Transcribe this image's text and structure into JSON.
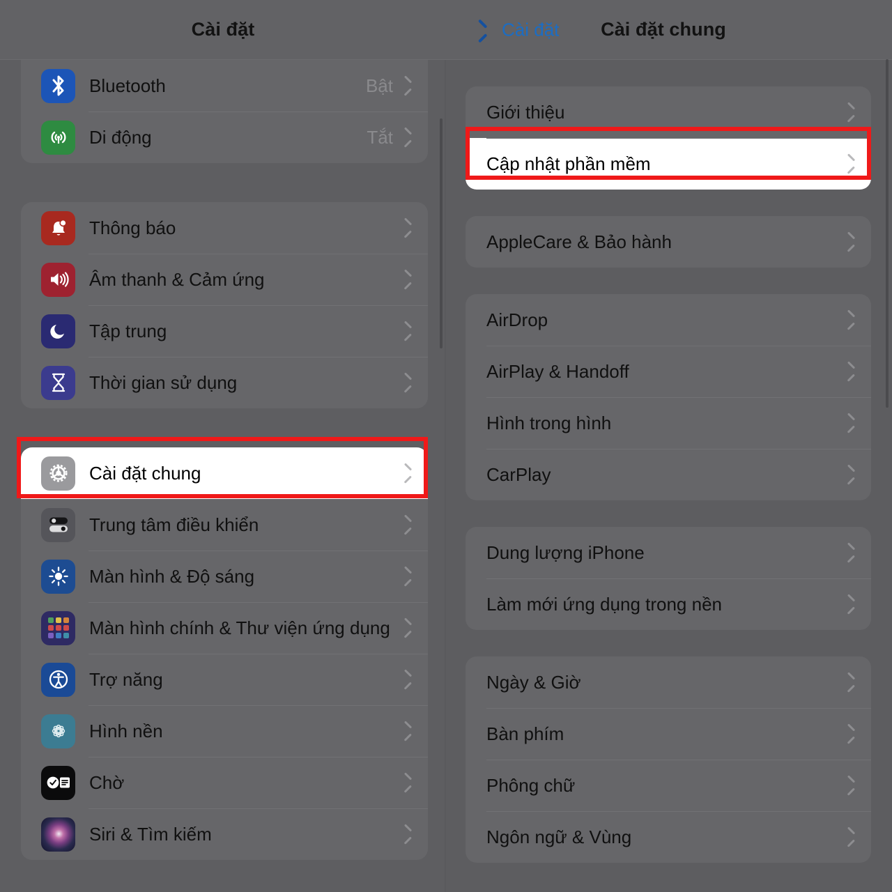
{
  "left_pane": {
    "nav": {
      "title": "Cài đặt"
    },
    "groups": [
      {
        "name": "connectivity",
        "rows": [
          {
            "label": "Bluetooth",
            "value": "Bật",
            "icon": "bluetooth-icon"
          },
          {
            "label": "Di động",
            "value": "Tắt",
            "icon": "cellular-icon"
          }
        ]
      },
      {
        "name": "notifications",
        "rows": [
          {
            "label": "Thông báo",
            "value": "",
            "icon": "notifications-icon"
          },
          {
            "label": "Âm thanh & Cảm ứng",
            "value": "",
            "icon": "sounds-haptics-icon"
          },
          {
            "label": "Tập trung",
            "value": "",
            "icon": "focus-icon"
          },
          {
            "label": "Thời gian sử dụng",
            "value": "",
            "icon": "screen-time-icon"
          }
        ]
      },
      {
        "name": "system",
        "rows": [
          {
            "label": "Cài đặt chung",
            "value": "",
            "icon": "general-gear-icon",
            "highlighted": true
          },
          {
            "label": "Trung tâm điều khiển",
            "value": "",
            "icon": "control-center-icon"
          },
          {
            "label": "Màn hình & Độ sáng",
            "value": "",
            "icon": "display-brightness-icon"
          },
          {
            "label": "Màn hình chính & Thư viện ứng dụng",
            "value": "",
            "icon": "home-screen-icon"
          },
          {
            "label": "Trợ năng",
            "value": "",
            "icon": "accessibility-icon"
          },
          {
            "label": "Hình nền",
            "value": "",
            "icon": "wallpaper-icon"
          },
          {
            "label": "Chờ",
            "value": "",
            "icon": "standby-icon"
          },
          {
            "label": "Siri & Tìm kiếm",
            "value": "",
            "icon": "siri-search-icon"
          }
        ]
      }
    ]
  },
  "right_pane": {
    "nav": {
      "back_label": "Cài đặt",
      "title": "Cài đặt chung"
    },
    "groups": [
      {
        "name": "about-update",
        "rows": [
          {
            "label": "Giới thiệu"
          },
          {
            "label": "Cập nhật phần mềm",
            "highlighted": true
          }
        ]
      },
      {
        "name": "applecare",
        "rows": [
          {
            "label": "AppleCare & Bảo hành"
          }
        ]
      },
      {
        "name": "sharing",
        "rows": [
          {
            "label": "AirDrop"
          },
          {
            "label": "AirPlay & Handoff"
          },
          {
            "label": "Hình trong hình"
          },
          {
            "label": "CarPlay"
          }
        ]
      },
      {
        "name": "storage",
        "rows": [
          {
            "label": "Dung lượng iPhone"
          },
          {
            "label": "Làm mới ứng dụng trong nền"
          }
        ]
      },
      {
        "name": "locale",
        "rows": [
          {
            "label": "Ngày & Giờ"
          },
          {
            "label": "Bàn phím"
          },
          {
            "label": "Phông chữ"
          },
          {
            "label": "Ngôn ngữ & Vùng"
          }
        ]
      }
    ]
  },
  "annotations": {
    "highlight_color": "#ef1919",
    "accent_link_color": "#1b6dc4",
    "dim_overlay_color": "#5d5d60"
  }
}
